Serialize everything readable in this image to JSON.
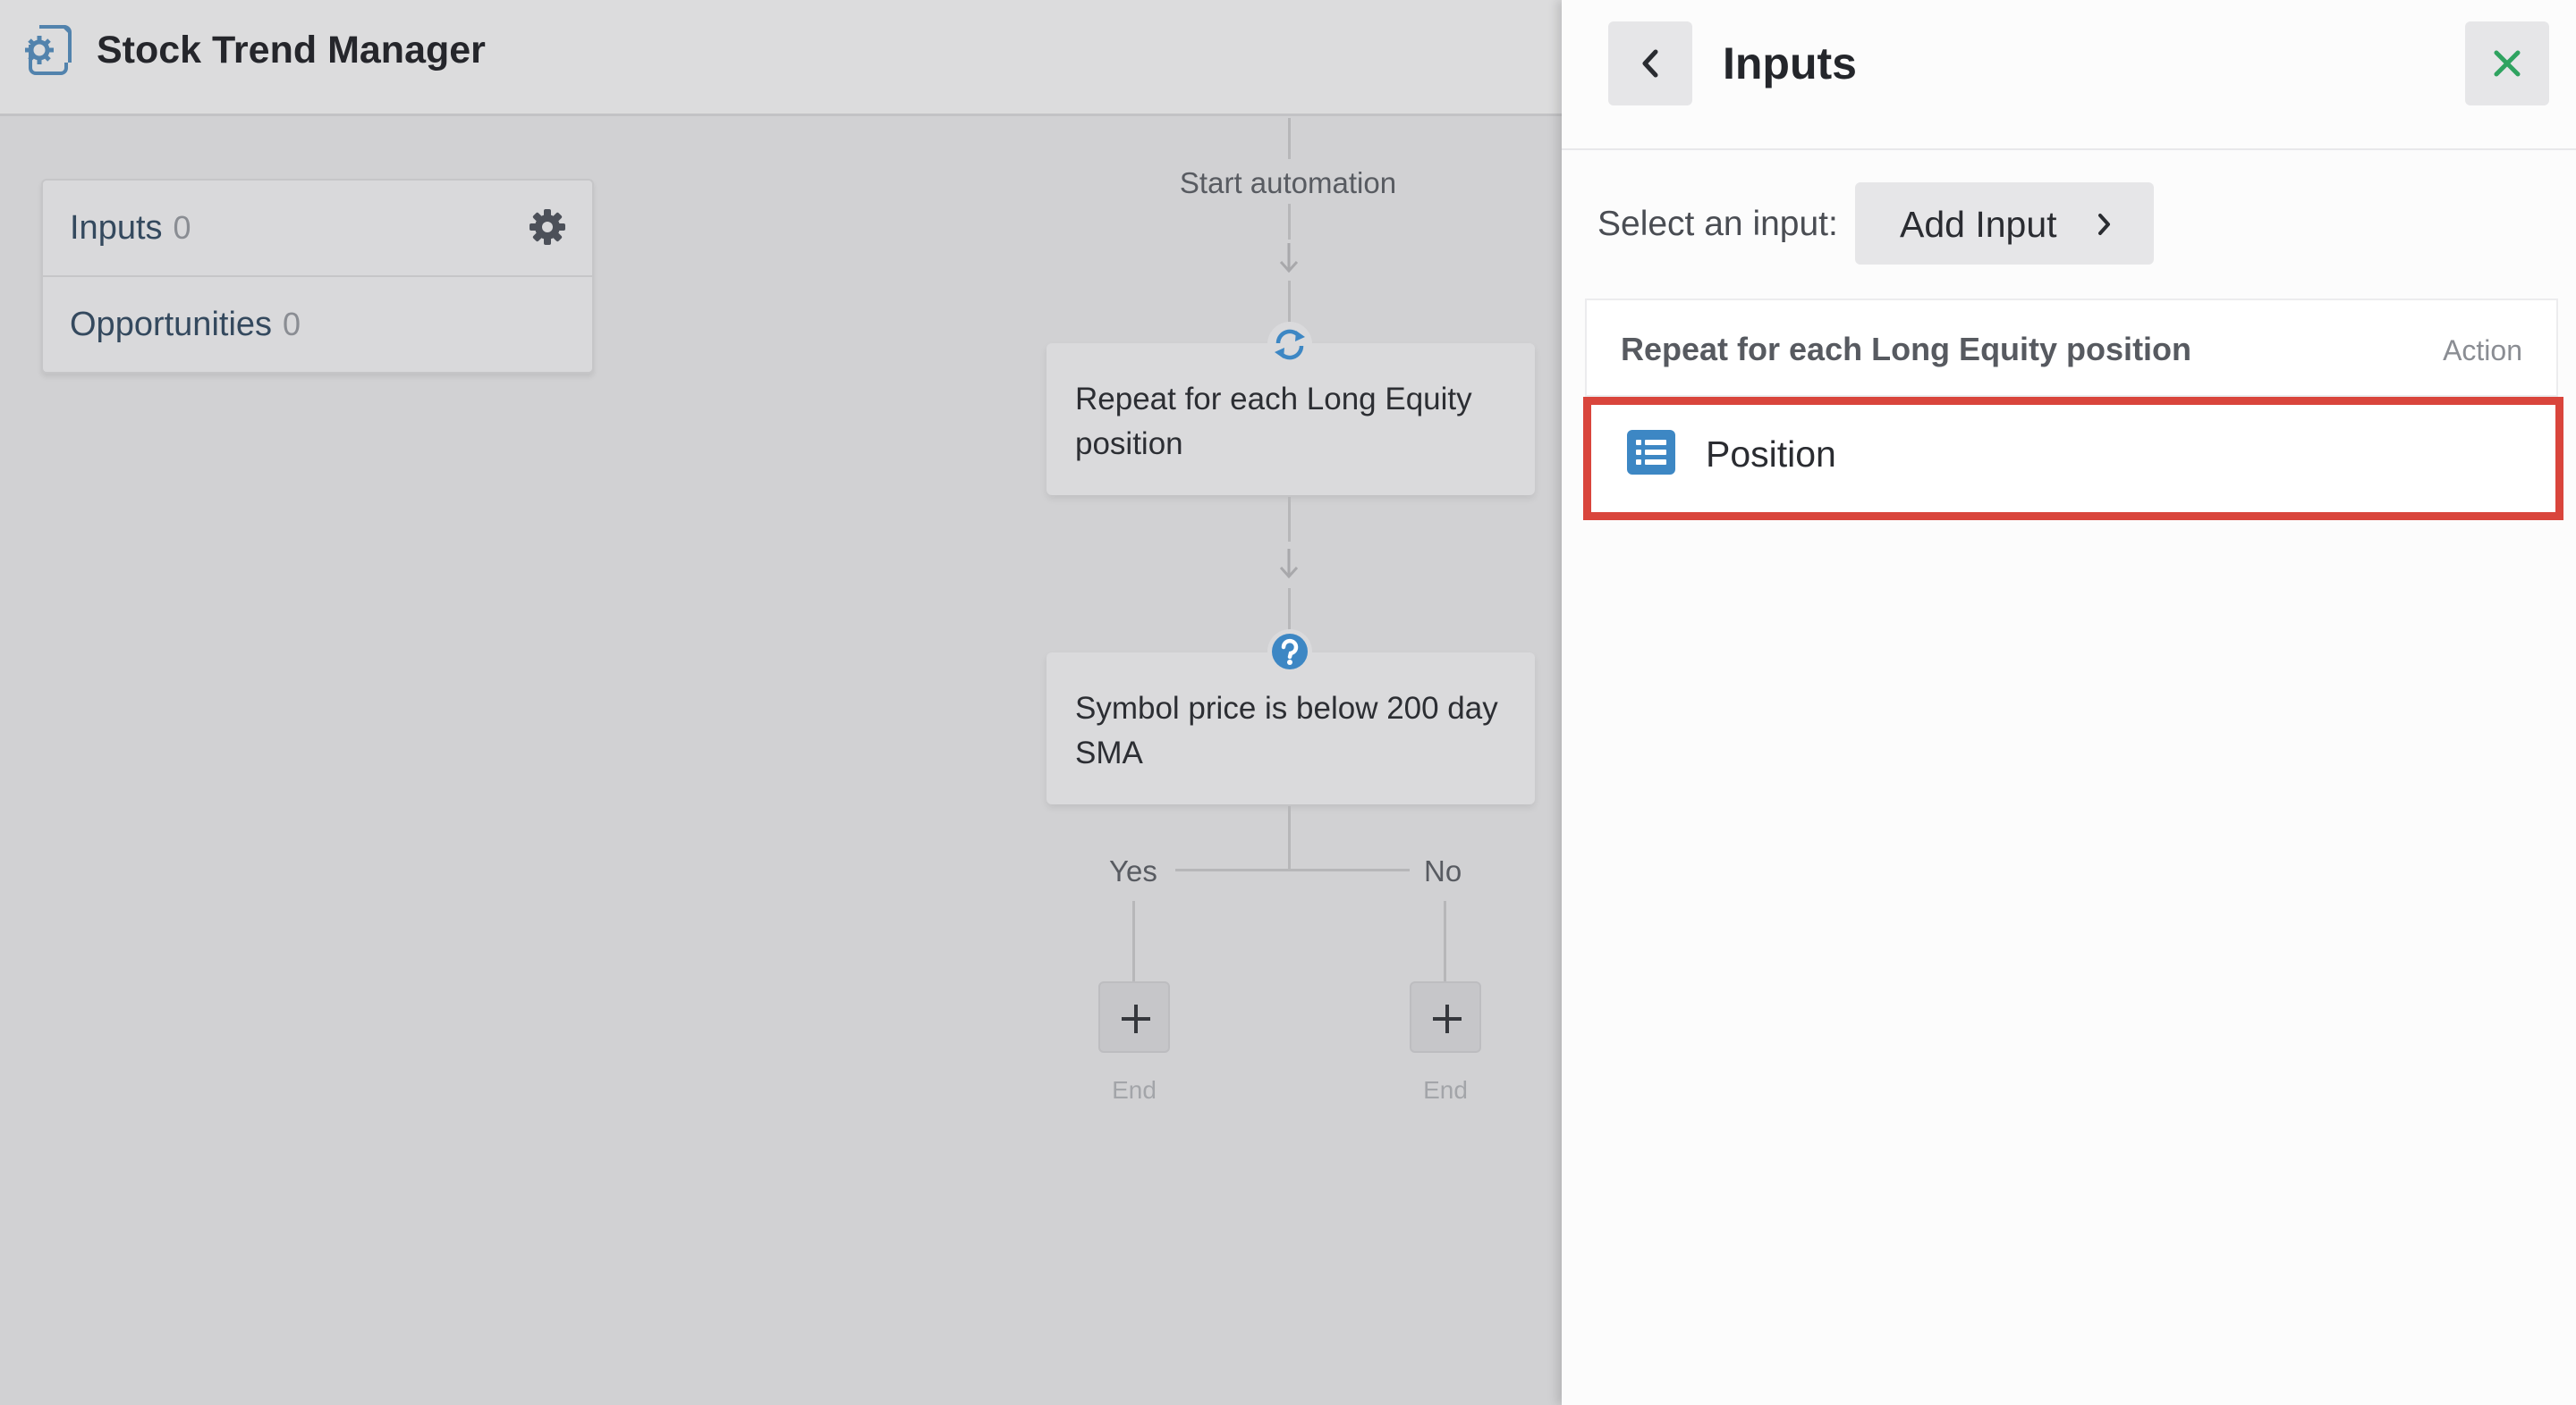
{
  "app": {
    "title": "Stock Trend Manager",
    "logo_icon": "gear-document-icon"
  },
  "sidebar_counts": {
    "items": [
      {
        "label": "Inputs",
        "count": "0",
        "icon": "gear-icon"
      },
      {
        "label": "Opportunities",
        "count": "0"
      }
    ]
  },
  "flow": {
    "start_label": "Start automation",
    "nodes": [
      {
        "text": "Repeat for each Long Equity position",
        "icon": "repeat-icon"
      },
      {
        "text": "Symbol price is below 200 day SMA",
        "icon": "question-icon"
      }
    ],
    "branches": {
      "yes_label": "Yes",
      "no_label": "No",
      "yes_end": "End",
      "no_end": "End"
    }
  },
  "panel": {
    "title": "Inputs",
    "select_label": "Select an input:",
    "add_input_label": "Add Input",
    "group": {
      "name": "Repeat for each Long Equity position",
      "type": "Action",
      "items": [
        {
          "label": "Position",
          "icon": "list-icon"
        }
      ]
    }
  },
  "colors": {
    "accent_blue": "#3d87c4",
    "close_green": "#2fa360",
    "highlight_red": "#d9453c"
  }
}
